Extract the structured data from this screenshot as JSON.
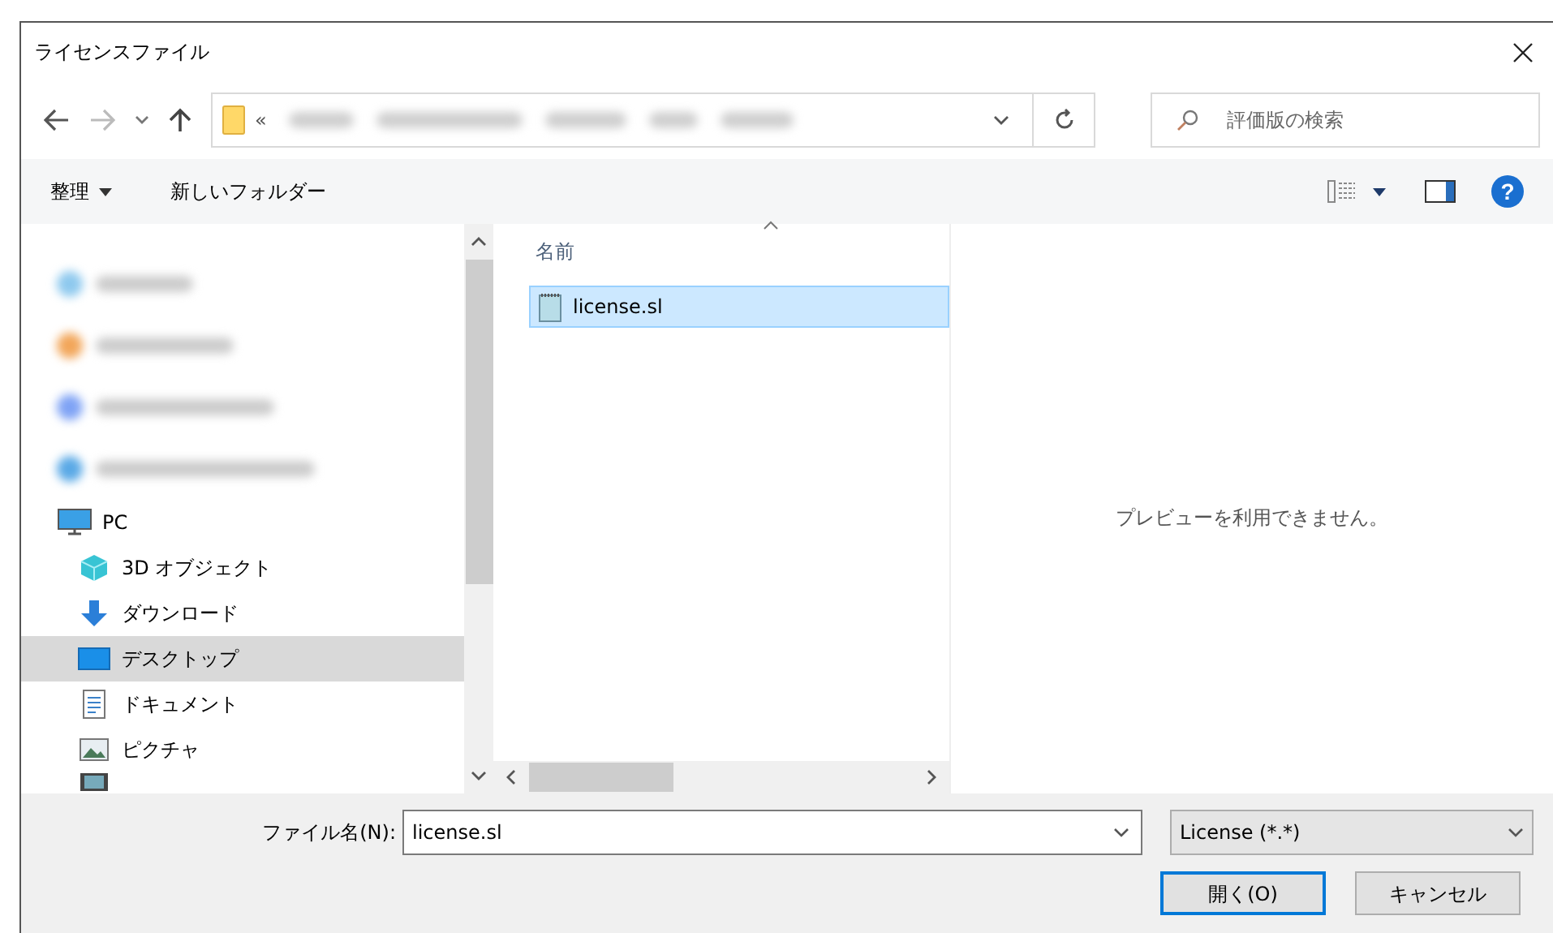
{
  "window": {
    "title": "ライセンスファイル"
  },
  "address": {
    "prefix": "«"
  },
  "search": {
    "placeholder": "評価版の検索"
  },
  "toolbar": {
    "organize": "整理",
    "new_folder": "新しいフォルダー",
    "help": "?"
  },
  "sidebar": {
    "items": [
      {
        "kind": "redacted",
        "color": "#8ec9ee"
      },
      {
        "kind": "redacted",
        "color": "#f2a65a"
      },
      {
        "kind": "redacted",
        "color": "#7fa3f5"
      },
      {
        "kind": "redacted",
        "color": "#5aa9e6"
      },
      {
        "kind": "pc",
        "label": "PC",
        "selected": false,
        "children": [
          {
            "kind": "cube",
            "label": "3D オブジェクト",
            "selected": false
          },
          {
            "kind": "download",
            "label": "ダウンロード",
            "selected": false
          },
          {
            "kind": "desktop",
            "label": "デスクトップ",
            "selected": true
          },
          {
            "kind": "document",
            "label": "ドキュメント",
            "selected": false
          },
          {
            "kind": "picture",
            "label": "ピクチャ",
            "selected": false
          },
          {
            "kind": "video",
            "selected": false
          }
        ]
      }
    ]
  },
  "files": {
    "columns": [
      {
        "label": "名前",
        "sorted": true
      }
    ],
    "rows": [
      {
        "name": "license.sl",
        "selected": true
      }
    ]
  },
  "preview": {
    "message": "プレビューを利用できません。"
  },
  "footer": {
    "filename_label": "ファイル名(N):",
    "filename": "license.sl",
    "filter": "License (*.*)",
    "buttons": [
      {
        "label": "開く(O)",
        "default": true
      },
      {
        "label": "キャンセル",
        "default": false
      }
    ]
  }
}
